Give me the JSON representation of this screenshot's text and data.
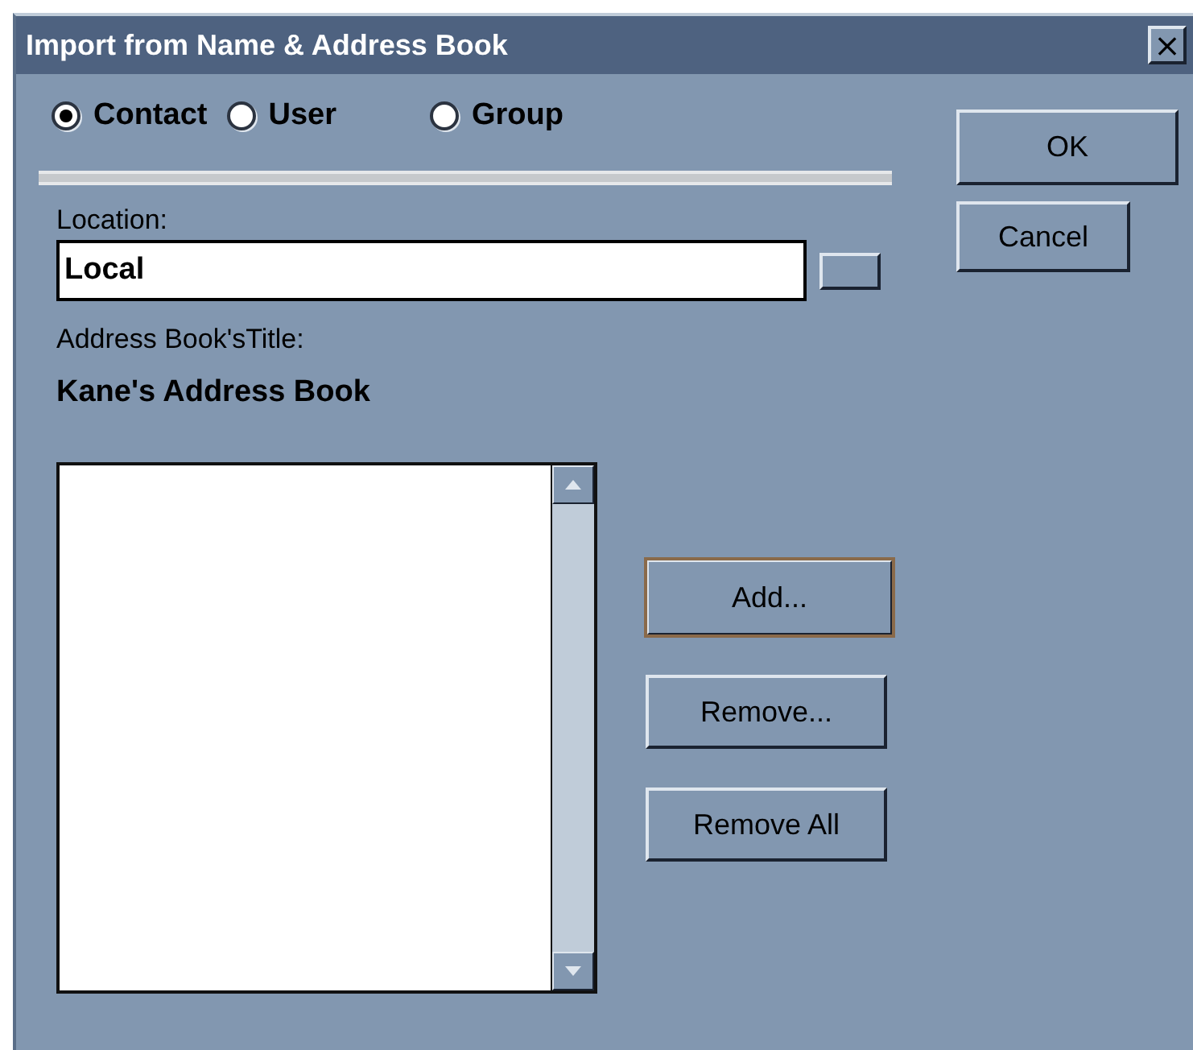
{
  "window": {
    "title": "Import from Name & Address Book",
    "close": "×"
  },
  "radios": [
    {
      "label": "Contact",
      "selected": true
    },
    {
      "label": "User",
      "selected": false
    },
    {
      "label": "Group",
      "selected": false
    }
  ],
  "location": {
    "label": "Location:",
    "value": "Local"
  },
  "address_book_title": {
    "label": "Address Book'sTitle:",
    "value": "Kane's Address Book"
  },
  "list_buttons": [
    {
      "label": "Add...",
      "default": true
    },
    {
      "label": "Remove...",
      "default": false
    },
    {
      "label": "Remove All",
      "default": false
    }
  ],
  "dialog_buttons": [
    "OK",
    "Cancel"
  ]
}
